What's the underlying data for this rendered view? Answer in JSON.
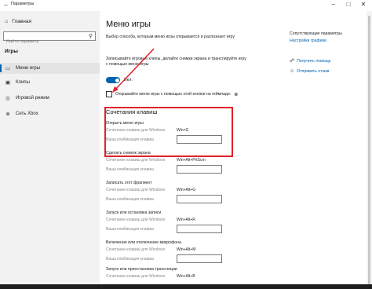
{
  "window": {
    "title": "Параметры"
  },
  "sidebar": {
    "home_label": "Главная",
    "search_placeholder": "Найти параметр",
    "section_title": "Игры",
    "items": [
      {
        "label": "Меню игры",
        "icon": "game-menu-icon"
      },
      {
        "label": "Клипы",
        "icon": "clips-icon"
      },
      {
        "label": "Игровой режим",
        "icon": "game-mode-icon"
      },
      {
        "label": "Сеть Xbox",
        "icon": "xbox-network-icon"
      }
    ]
  },
  "main": {
    "title": "Меню игры",
    "description": "Выбор способа, которым меню игры открывается и распознает игру",
    "record_text": "Записывайте игровые клипы, делайте снимки экрана и транслируйте игру с помощью меню игры",
    "toggle_label": "Вкл.",
    "checkbox_label": "Открывайте меню игры с помощью этой кнопки на геймпаде:",
    "shortcuts_title": "Сочетания клавиш",
    "win_label": "Сочетание клавиш для Windows",
    "custom_label": "Ваша комбинация клавиш",
    "shortcuts": [
      {
        "name": "Открыть меню игры",
        "win": "Win+G"
      },
      {
        "name": "Сделать снимок экрана",
        "win": "Win+Alt+PrtScrn"
      },
      {
        "name": "Записать этот фрагмент",
        "win": "Win+Alt+G"
      },
      {
        "name": "Запуск или остановка записи",
        "win": "Win+Alt+R"
      },
      {
        "name": "Включение или отключение микрофона",
        "win": "Win+Alt+M"
      },
      {
        "name": "Запуск или приостановка трансляции",
        "win": "Win+Alt+B"
      }
    ]
  },
  "right": {
    "related_title": "Сопутствующие параметры",
    "graphics_link": "Настройки графики",
    "help_link": "Получить помощь",
    "feedback_link": "Отправить отзыв"
  },
  "colors": {
    "accent": "#0063b1",
    "highlight": "#e0202a"
  }
}
